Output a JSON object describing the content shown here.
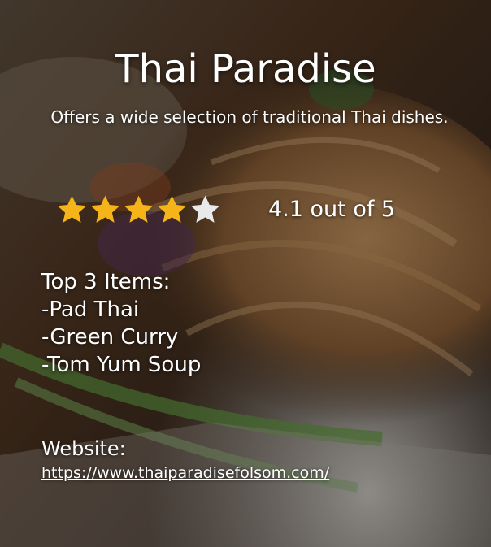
{
  "restaurant": {
    "name": "Thai Paradise",
    "description": "Offers a wide selection of traditional Thai dishes."
  },
  "rating": {
    "value": 4.1,
    "max": 5,
    "label": "4.1 out of 5",
    "filled_color": "#f5b519",
    "empty_color": "#e9e9e9"
  },
  "top_items": {
    "heading": "Top 3 Items:",
    "items": [
      "-Pad Thai",
      "-Green Curry",
      "-Tom Yum Soup"
    ]
  },
  "website": {
    "label": "Website:",
    "url": "https://www.thaiparadisefolsom.com/"
  },
  "background": {
    "subject": "food-photo-pad-thai"
  }
}
